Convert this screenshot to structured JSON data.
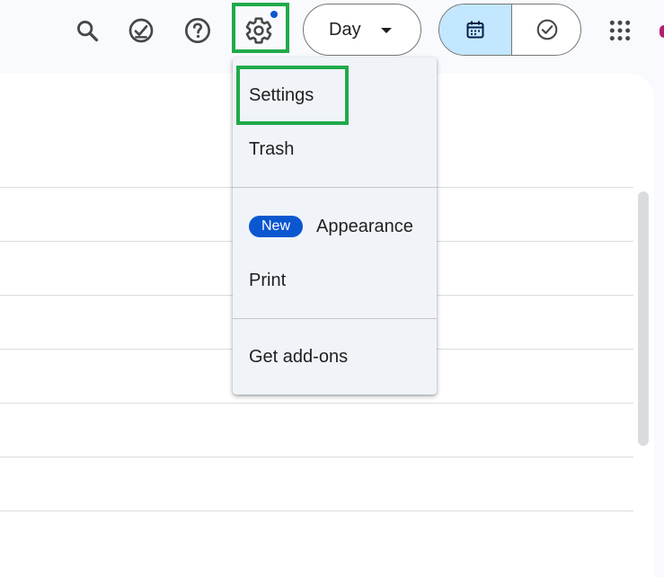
{
  "toolbar": {
    "search_icon": "search-icon",
    "tasks_icon": "task-alt-icon",
    "help_icon": "help-icon",
    "settings_icon": "gear-icon",
    "view_label": "Day",
    "apps_icon": "apps-grid-icon"
  },
  "view_toggle": {
    "calendar_icon": "calendar-icon",
    "tasks_icon": "check-circle-icon",
    "selected": "calendar"
  },
  "settings_menu": {
    "items": [
      {
        "label": "Settings"
      },
      {
        "label": "Trash"
      },
      {
        "label": "Appearance",
        "badge": "New"
      },
      {
        "label": "Print"
      },
      {
        "label": "Get add-ons"
      }
    ]
  },
  "colors": {
    "accent": "#0b57d0",
    "selected_segment": "#c2e7ff",
    "highlight_box": "#1faa4a",
    "menu_background": "#f0f4f9"
  }
}
